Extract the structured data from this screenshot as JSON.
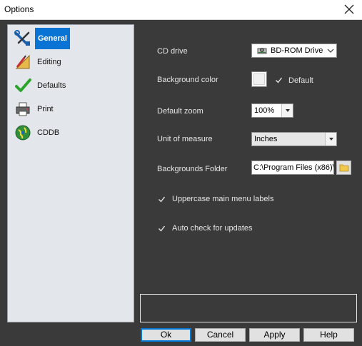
{
  "window": {
    "title": "Options"
  },
  "nav": {
    "items": [
      {
        "label": "General",
        "icon": "tools-icon",
        "selected": true
      },
      {
        "label": "Editing",
        "icon": "ruler-pencil-icon",
        "selected": false
      },
      {
        "label": "Defaults",
        "icon": "checkmark-icon",
        "selected": false
      },
      {
        "label": "Print",
        "icon": "printer-icon",
        "selected": false
      },
      {
        "label": "CDDB",
        "icon": "globe-disc-icon",
        "selected": false
      }
    ]
  },
  "form": {
    "cd_drive": {
      "label": "CD drive",
      "value": "BD-ROM Drive"
    },
    "background_color": {
      "label": "Background color",
      "default_label": "Default",
      "default_checked": true,
      "swatch_color": "#f0f0f0"
    },
    "default_zoom": {
      "label": "Default zoom",
      "value": "100%"
    },
    "unit_of_measure": {
      "label": "Unit of measure",
      "value": "Inches"
    },
    "backgrounds_folder": {
      "label": "Backgrounds Folder",
      "value": "C:\\Program Files (x86)\\"
    },
    "uppercase_labels": {
      "label": "Uppercase main menu labels",
      "checked": true
    },
    "auto_check": {
      "label": "Auto check for updates",
      "checked": true
    }
  },
  "buttons": {
    "ok": "Ok",
    "cancel": "Cancel",
    "apply": "Apply",
    "help": "Help"
  },
  "colors": {
    "dialog_bg": "#3a3a3a",
    "nav_bg": "#e3e6eb",
    "selected": "#0a74d4",
    "focus_border": "#0078d7"
  }
}
